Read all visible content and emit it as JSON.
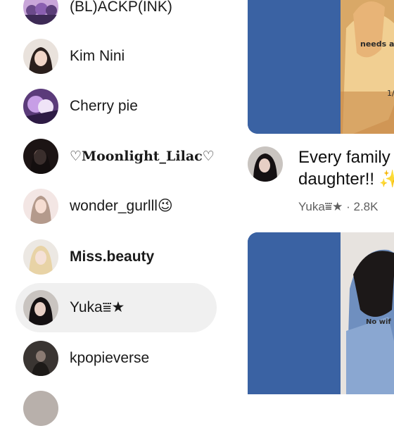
{
  "sidebar": {
    "channels": [
      {
        "label": "(BL)ACKP(INK)",
        "style": "normal"
      },
      {
        "label": "Kim Nini",
        "style": "normal"
      },
      {
        "label": "Cherry pie",
        "style": "normal"
      },
      {
        "label": "♡Moonlight_Lilac♡",
        "style": "serif-bold"
      },
      {
        "label": "wonder_gurlll😉",
        "style": "normal"
      },
      {
        "label": "Miss.beauty",
        "style": "bold"
      },
      {
        "label": "Yuka⩸★",
        "style": "normal",
        "selected": true
      },
      {
        "label": "kpopieverse",
        "style": "normal"
      }
    ]
  },
  "feed": {
    "thumb1_text": [
      "needs a",
      "1/"
    ],
    "video": {
      "title_line1": "Every family",
      "title_line2": "daughter!! ✨",
      "subtitle": "Yuka⩸★ · 2.8K"
    },
    "thumb2_text": "No wif"
  },
  "colors": {
    "selected_bg": "#f0f0f0",
    "thumb_blue": "#3a62a3",
    "subtitle_gray": "#606060"
  }
}
